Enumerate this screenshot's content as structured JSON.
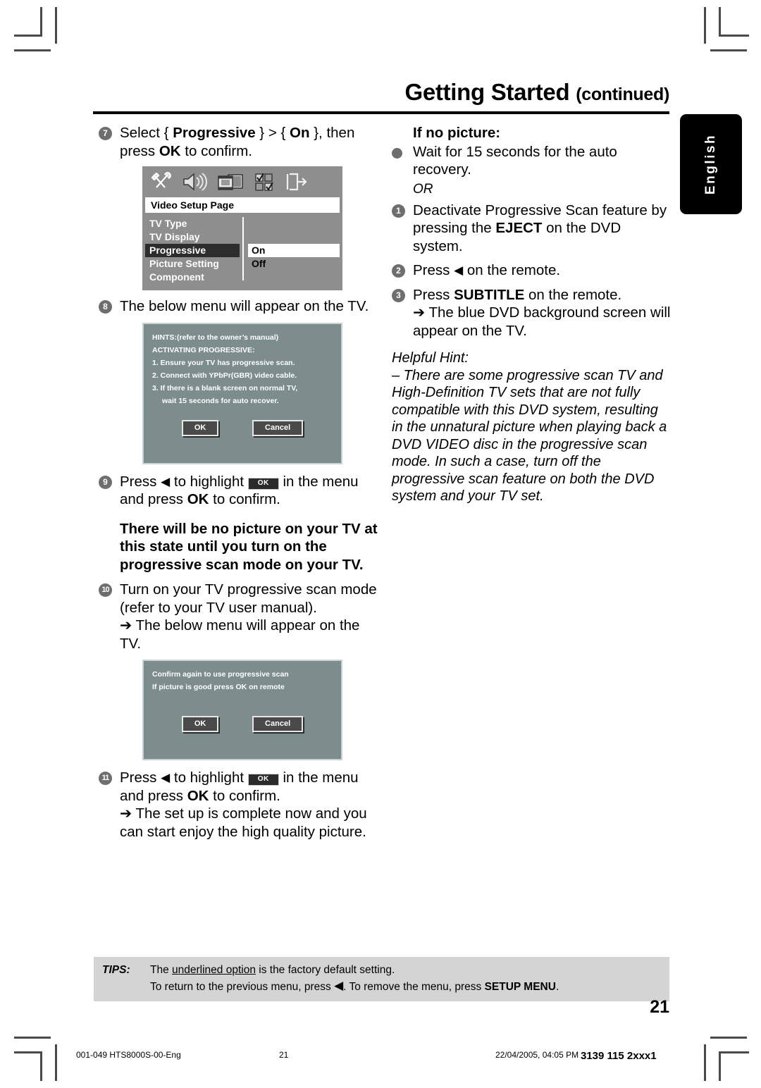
{
  "header": {
    "title": "Getting Started",
    "continued": "(continued)"
  },
  "side_tab": {
    "label": "English"
  },
  "left_column": {
    "step7": {
      "num": "7",
      "line1_pre": "Select { ",
      "line1_b1": "Progressive",
      "line1_mid": " } > { ",
      "line1_b2": "On",
      "line1_post": " }, then",
      "line2_pre": "press ",
      "line2_b": "OK",
      "line2_post": " to confirm."
    },
    "osd": {
      "title": "Video Setup Page",
      "icons": [
        "tools-icon",
        "speaker-icon",
        "video-icon",
        "preferences-icon",
        "exit-icon"
      ],
      "menu_items": [
        "TV Type",
        "TV Display",
        "Progressive",
        "Picture Setting",
        "Component"
      ],
      "selected_item": "Progressive",
      "options": [
        "On",
        "Off"
      ],
      "selected_option": "On"
    },
    "step8": {
      "num": "8",
      "text": "The below menu will appear on the TV."
    },
    "hints_dialog": {
      "lines": [
        "HINTS:(refer to the owner’s manual)",
        "ACTIVATING PROGRESSIVE:",
        "1. Ensure your TV has progressive scan.",
        "2. Connect with YPbPr(GBR) video cable.",
        "3. If there is a blank screen on normal TV,"
      ],
      "indent_line": "wait 15 seconds for auto recover.",
      "ok_label": "OK",
      "cancel_label": "Cancel"
    },
    "step9": {
      "num": "9",
      "line1_pre": "Press ",
      "line1_tri": "◀",
      "line1_mid": " to highlight ",
      "line1_key": "OK",
      "line1_post": " in the menu",
      "line2_pre": "and press ",
      "line2_b": "OK",
      "line2_post": " to confirm."
    },
    "warning": "There will be no picture on your TV at this state until you turn on the progressive scan mode on your TV.",
    "step10": {
      "num": "10",
      "line1": "Turn on your TV progressive scan mode",
      "line2": "(refer to your TV user manual).",
      "line3_arrow": "➔",
      "line3": " The below menu will appear on the TV."
    },
    "confirm_dialog": {
      "lines": [
        "Confirm again to use progressive scan",
        "If picture is good press OK on remote"
      ],
      "ok_label": "OK",
      "cancel_label": "Cancel"
    },
    "step11": {
      "num": "11",
      "line1_pre": "Press ",
      "line1_tri": "◀",
      "line1_mid": " to highlight ",
      "line1_key": "OK",
      "line1_post": " in the menu",
      "line2_pre": "and press ",
      "line2_b": "OK",
      "line2_post": " to confirm.",
      "line3_arrow": "➔",
      "line3": " The set up is complete now and you",
      "line4": "can start enjoy the high quality picture."
    }
  },
  "right_column": {
    "heading": "If no picture:",
    "bullet": "Wait for 15 seconds for the auto recovery.",
    "or": "OR",
    "step1": {
      "num": "1",
      "line1": "Deactivate Progressive Scan feature by",
      "line2_pre": "pressing the ",
      "line2_b": "EJECT",
      "line2_post": " on the DVD system."
    },
    "step2": {
      "num": "2",
      "pre": "Press ",
      "tri": "◀",
      "post": " on the remote."
    },
    "step3": {
      "num": "3",
      "line1_pre": "Press ",
      "line1_b": "SUBTITLE",
      "line1_post": " on the remote.",
      "line2_arrow": "➔",
      "line2": " The blue DVD background screen will",
      "line3": "appear on the TV."
    },
    "helpful_hint": {
      "title": "Helpful Hint:",
      "body": "–  There are some progressive scan TV and High-Definition TV sets that are not fully compatible with this DVD system, resulting in the unnatural picture when playing back a DVD VIDEO disc in the progressive scan mode.  In such a case, turn off the progressive scan feature on both the DVD system and your TV set."
    }
  },
  "tips": {
    "label": "TIPS:",
    "line1_pre": "The ",
    "line1_u": "underlined option",
    "line1_post": " is the factory default setting.",
    "line2_pre": "To return to the previous menu, press ",
    "line2_tri": "◀",
    "line2_mid": ". To remove the menu, press ",
    "line2_b": "SETUP MENU",
    "line2_post": "."
  },
  "page_number": "21",
  "print_footer": {
    "file": "001-049 HTS8000S-00-Eng",
    "page": "21",
    "date": "22/04/2005, 04:05 PM",
    "code": "3139 115 2xxx1"
  }
}
